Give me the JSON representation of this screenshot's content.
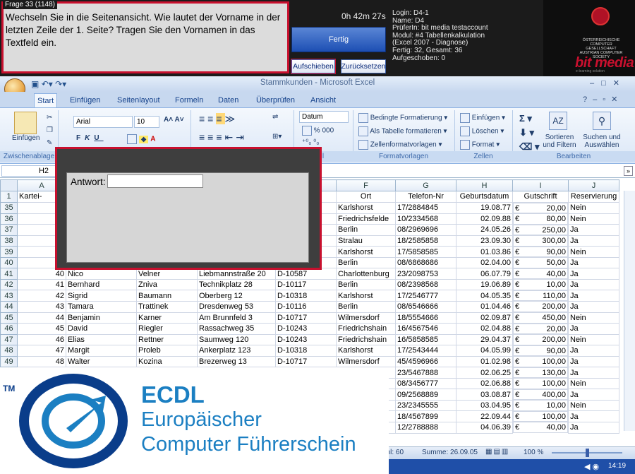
{
  "exam": {
    "question_label": "Frage 33 (1148)",
    "question_text": "Wechseln Sie in die Seitenansicht. Wie lautet der Vorname in der letzten Zeile der 1. Seite? Tragen Sie den Vornamen in das Textfeld ein.",
    "timer": "0h 42m 27s",
    "finish_label": "Fertig",
    "defer_label": "Aufschieben",
    "reset_label": "Zurücksetzen",
    "info": [
      "Login: D4-1",
      "Name: D4",
      "PrüferIn:  bit media testaccount",
      "Modul: #4 Tabellenkalkulation",
      "(Excel 2007 - Diagnose)",
      "Fertig: 32, Gesamt: 36",
      "Aufgeschoben: 0"
    ],
    "seal_text": "ÖSTERREICHISCHE COMPUTER GESELLSCHAFT AUSTRIAN COMPUTER SOCIETY",
    "brand": "bit media",
    "brand_tag": "e-learning solution"
  },
  "excel": {
    "window_title": "Stammkunden - Microsoft Excel",
    "tabs": [
      "Start",
      "Einfügen",
      "Seitenlayout",
      "Formeln",
      "Daten",
      "Überprüfen",
      "Ansicht"
    ],
    "ribbon": {
      "paste": "Einfügen",
      "font_name": "Arial",
      "font_size": "10",
      "number_format": "Datum",
      "cond_format": "Bedingte Formatierung",
      "table_format": "Als Tabelle formatieren",
      "cell_styles": "Zellenformatvorlagen",
      "insert": "Einfügen",
      "delete": "Löschen",
      "format": "Format",
      "sort": "Sortieren",
      "sort2": "und Filtern",
      "find": "Suchen und",
      "find2": "Auswählen",
      "percent": "%",
      "thousands": "000",
      "groups": [
        "Zwischenablage",
        "l",
        "Formatvorlagen",
        "Zellen",
        "Bearbeiten"
      ]
    },
    "name_box": "H2",
    "columns": [
      "A",
      "F",
      "G",
      "H",
      "I",
      "J"
    ],
    "headers": [
      "Kartei-",
      "",
      "",
      "",
      "",
      "Ort",
      "Telefon-Nr",
      "Geburtsdatum",
      "Gutschrift",
      "Reservierung"
    ],
    "rows": [
      {
        "r": "35",
        "a": "",
        "b": "",
        "c": "",
        "d": "",
        "e": "",
        "f": "Karlshorst",
        "g": "17/2884845",
        "h": "19.08.77",
        "cur": "€",
        "i": "20,00",
        "j": "Nein"
      },
      {
        "r": "36",
        "a": "",
        "b": "",
        "c": "",
        "d": "",
        "e": "",
        "f": "Friedrichsfelde",
        "g": "10/2334568",
        "h": "02.09.88",
        "cur": "€",
        "i": "80,00",
        "j": "Nein"
      },
      {
        "r": "37",
        "a": "",
        "b": "",
        "c": "",
        "d": "",
        "e": "",
        "f": "Berlin",
        "g": "08/2969696",
        "h": "24.05.26",
        "cur": "€",
        "i": "250,00",
        "j": "Ja"
      },
      {
        "r": "38",
        "a": "",
        "b": "",
        "c": "",
        "d": "",
        "e": "",
        "f": "Stralau",
        "g": "18/2585858",
        "h": "23.09.30",
        "cur": "€",
        "i": "300,00",
        "j": "Ja"
      },
      {
        "r": "39",
        "a": "",
        "b": "",
        "c": "",
        "d": "",
        "e": "",
        "f": "Karlshorst",
        "g": "17/5858585",
        "h": "01.03.86",
        "cur": "€",
        "i": "90,00",
        "j": "Nein"
      },
      {
        "r": "40",
        "a": "",
        "b": "",
        "c": "",
        "d": "",
        "e": "",
        "f": "Berlin",
        "g": "08/6868686",
        "h": "02.04.00",
        "cur": "€",
        "i": "50,00",
        "j": "Ja"
      },
      {
        "r": "41",
        "a": "40",
        "b": "Nico",
        "c": "Velner",
        "d": "Liebmannstraße 20",
        "e": "D-10587",
        "f": "Charlottenburg",
        "g": "23/2098753",
        "h": "06.07.79",
        "cur": "€",
        "i": "40,00",
        "j": "Ja"
      },
      {
        "r": "42",
        "a": "41",
        "b": "Bernhard",
        "c": "Zniva",
        "d": "Technikplatz 28",
        "e": "D-10117",
        "f": "Berlin",
        "g": "08/2398568",
        "h": "19.06.89",
        "cur": "€",
        "i": "10,00",
        "j": "Ja"
      },
      {
        "r": "43",
        "a": "42",
        "b": "Sigrid",
        "c": "Baumann",
        "d": "Oberberg 12",
        "e": "D-10318",
        "f": "Karlshorst",
        "g": "17/2546777",
        "h": "04.05.35",
        "cur": "€",
        "i": "110,00",
        "j": "Ja"
      },
      {
        "r": "44",
        "a": "43",
        "b": "Tamara",
        "c": "Trattinek",
        "d": "Dresdenweg 53",
        "e": "D-10116",
        "f": "Berlin",
        "g": "08/6546666",
        "h": "01.04.46",
        "cur": "€",
        "i": "200,00",
        "j": "Ja"
      },
      {
        "r": "45",
        "a": "44",
        "b": "Benjamin",
        "c": "Karner",
        "d": "Am Brunnfeld 3",
        "e": "D-10717",
        "f": "Wilmersdorf",
        "g": "18/5554666",
        "h": "02.09.87",
        "cur": "€",
        "i": "450,00",
        "j": "Nein"
      },
      {
        "r": "46",
        "a": "45",
        "b": "David",
        "c": "Riegler",
        "d": "Rassachweg 35",
        "e": "D-10243",
        "f": "Friedrichshain",
        "g": "16/4567546",
        "h": "02.04.88",
        "cur": "€",
        "i": "20,00",
        "j": "Ja"
      },
      {
        "r": "47",
        "a": "46",
        "b": "Elias",
        "c": "Rettner",
        "d": "Saumweg 120",
        "e": "D-10243",
        "f": "Friedrichshain",
        "g": "16/5858585",
        "h": "29.04.37",
        "cur": "€",
        "i": "200,00",
        "j": "Nein"
      },
      {
        "r": "48",
        "a": "47",
        "b": "Margit",
        "c": "Proleb",
        "d": "Ankerplatz 123",
        "e": "D-10318",
        "f": "Karlshorst",
        "g": "17/2543444",
        "h": "04.05.99",
        "cur": "€",
        "i": "90,00",
        "j": "Ja"
      },
      {
        "r": "49",
        "a": "48",
        "b": "Walter",
        "c": "Kozina",
        "d": "Brezerweg 13",
        "e": "D-10717",
        "f": "Wilmersdorf",
        "g": "45/4596966",
        "h": "01.02.98",
        "cur": "€",
        "i": "100,00",
        "j": "Ja"
      },
      {
        "r": "",
        "a": "",
        "b": "",
        "c": "",
        "d": "",
        "e": "",
        "f": "",
        "g": "23/5467888",
        "h": "02.06.25",
        "cur": "€",
        "i": "130,00",
        "j": "Ja"
      },
      {
        "r": "",
        "a": "",
        "b": "",
        "c": "",
        "d": "",
        "e": "",
        "f": "",
        "g": "08/3456777",
        "h": "02.06.88",
        "cur": "€",
        "i": "100,00",
        "j": "Nein"
      },
      {
        "r": "",
        "a": "",
        "b": "",
        "c": "",
        "d": "",
        "e": "",
        "f": "",
        "g": "09/2568889",
        "h": "03.08.87",
        "cur": "€",
        "i": "400,00",
        "j": "Ja"
      },
      {
        "r": "",
        "a": "",
        "b": "",
        "c": "",
        "d": "",
        "e": "",
        "f": "",
        "g": "23/2345555",
        "h": "03.04.95",
        "cur": "€",
        "i": "10,00",
        "j": "Nein"
      },
      {
        "r": "",
        "a": "",
        "b": "",
        "c": "",
        "d": "",
        "e": "",
        "f": "",
        "g": "18/4567899",
        "h": "22.09.44",
        "cur": "€",
        "i": "100,00",
        "j": "Ja"
      },
      {
        "r": "",
        "a": "",
        "b": "",
        "c": "",
        "d": "",
        "e": "",
        "f": "",
        "g": "12/2788888",
        "h": "04.06.39",
        "cur": "€",
        "i": "40,00",
        "j": "Ja"
      }
    ],
    "status_count": "ahl: 60",
    "status_sum": "Summe: 26.09.05",
    "zoom": "100 %",
    "clock": "14:19"
  },
  "dialog": {
    "answer_label": "Antwort:",
    "answer_value": ""
  },
  "ecdl": {
    "tm": "TM",
    "word": "ECDL",
    "line1": "Europäischer",
    "line2": "Computer Führerschein"
  }
}
